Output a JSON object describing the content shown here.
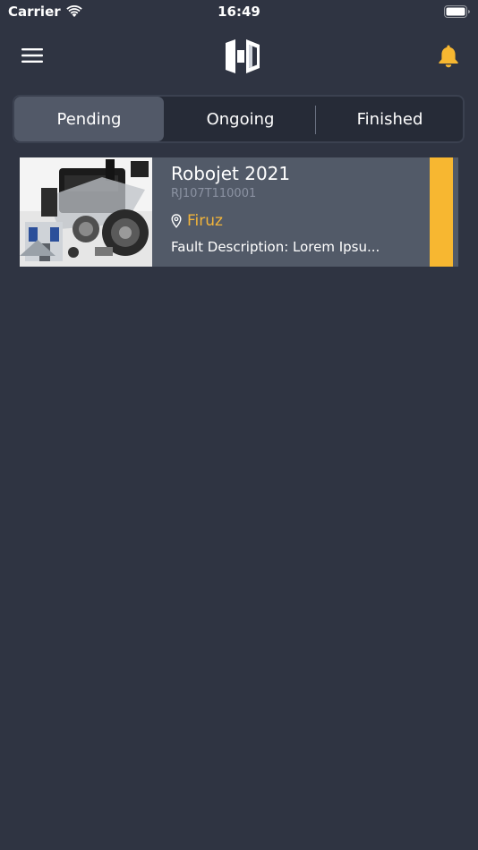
{
  "status_bar": {
    "carrier": "Carrier",
    "time": "16:49"
  },
  "nav": {
    "menu_icon": "hamburger-icon",
    "logo_icon": "app-logo",
    "notification_icon": "bell-icon",
    "accent_color": "#f7b731"
  },
  "tabs": [
    {
      "label": "Pending",
      "active": true
    },
    {
      "label": "Ongoing",
      "active": false
    },
    {
      "label": "Finished",
      "active": false
    }
  ],
  "jobs": [
    {
      "title": "Robojet 2021",
      "serial": "RJ107T110001",
      "location": "Firuz",
      "description": "Fault Description: Lorem Ipsu...",
      "status_color": "#f7b731"
    }
  ]
}
